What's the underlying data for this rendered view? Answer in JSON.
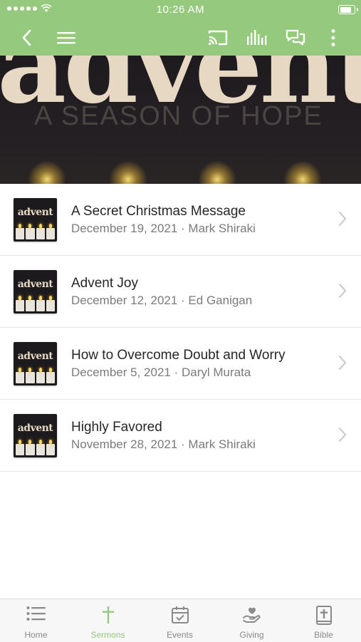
{
  "status_bar": {
    "time": "10:26 AM"
  },
  "hero": {
    "title": "advent",
    "subtitle": "A SEASON OF HOPE"
  },
  "sermons": [
    {
      "thumb_word": "advent",
      "title": "A Secret Christmas Message",
      "meta": "December 19, 2021 · Mark Shiraki"
    },
    {
      "thumb_word": "advent",
      "title": "Advent Joy",
      "meta": "December 12, 2021 · Ed Ganigan"
    },
    {
      "thumb_word": "advent",
      "title": "How to Overcome Doubt and Worry",
      "meta": "December 5, 2021 · Daryl Murata"
    },
    {
      "thumb_word": "advent",
      "title": "Highly Favored",
      "meta": "November 28, 2021 · Mark Shiraki"
    }
  ],
  "tabs": [
    {
      "label": "Home",
      "icon": "list-icon",
      "active": false
    },
    {
      "label": "Sermons",
      "icon": "cross-icon",
      "active": true
    },
    {
      "label": "Events",
      "icon": "calendar-check-icon",
      "active": false
    },
    {
      "label": "Giving",
      "icon": "giving-hand-icon",
      "active": false
    },
    {
      "label": "Bible",
      "icon": "bible-icon",
      "active": false
    }
  ],
  "colors": {
    "accent": "#95c97e",
    "text_primary": "#262626",
    "text_secondary": "#7b7b7b"
  }
}
